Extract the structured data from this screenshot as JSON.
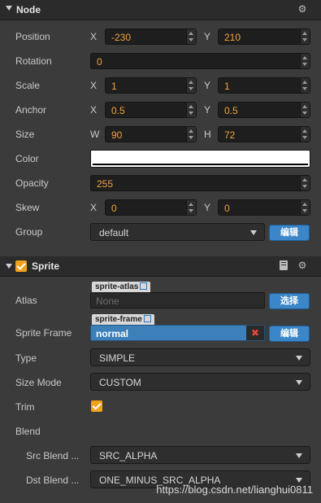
{
  "node": {
    "title": "Node",
    "position": {
      "label": "Position",
      "x_axis": "X",
      "x": "-230",
      "y_axis": "Y",
      "y": "210"
    },
    "rotation": {
      "label": "Rotation",
      "value": "0"
    },
    "scale": {
      "label": "Scale",
      "x_axis": "X",
      "x": "1",
      "y_axis": "Y",
      "y": "1"
    },
    "anchor": {
      "label": "Anchor",
      "x_axis": "X",
      "x": "0.5",
      "y_axis": "Y",
      "y": "0.5"
    },
    "size": {
      "label": "Size",
      "w_axis": "W",
      "w": "90",
      "h_axis": "H",
      "h": "72"
    },
    "color": {
      "label": "Color",
      "value": "#ffffff"
    },
    "opacity": {
      "label": "Opacity",
      "value": "255"
    },
    "skew": {
      "label": "Skew",
      "x_axis": "X",
      "x": "0",
      "y_axis": "Y",
      "y": "0"
    },
    "group": {
      "label": "Group",
      "value": "default",
      "button": "编辑"
    }
  },
  "sprite": {
    "title": "Sprite",
    "enabled": true,
    "atlas": {
      "label": "Atlas",
      "tag": "sprite-atlas",
      "value": "None",
      "button": "选择"
    },
    "sprite_frame": {
      "label": "Sprite Frame",
      "tag": "sprite-frame",
      "value": "normal",
      "button": "编辑"
    },
    "type": {
      "label": "Type",
      "value": "SIMPLE"
    },
    "size_mode": {
      "label": "Size Mode",
      "value": "CUSTOM"
    },
    "trim": {
      "label": "Trim",
      "checked": true
    },
    "blend": {
      "label": "Blend"
    },
    "src_blend": {
      "label": "Src Blend ...",
      "value": "SRC_ALPHA"
    },
    "dst_blend": {
      "label": "Dst Blend ...",
      "value": "ONE_MINUS_SRC_ALPHA"
    }
  },
  "watermark": "https://blog.csdn.net/lianghui0811",
  "colors": {
    "accent": "#f2a33a",
    "button": "#3a86c8",
    "panel": "#3b3b3b",
    "header": "#2b2b2b"
  }
}
